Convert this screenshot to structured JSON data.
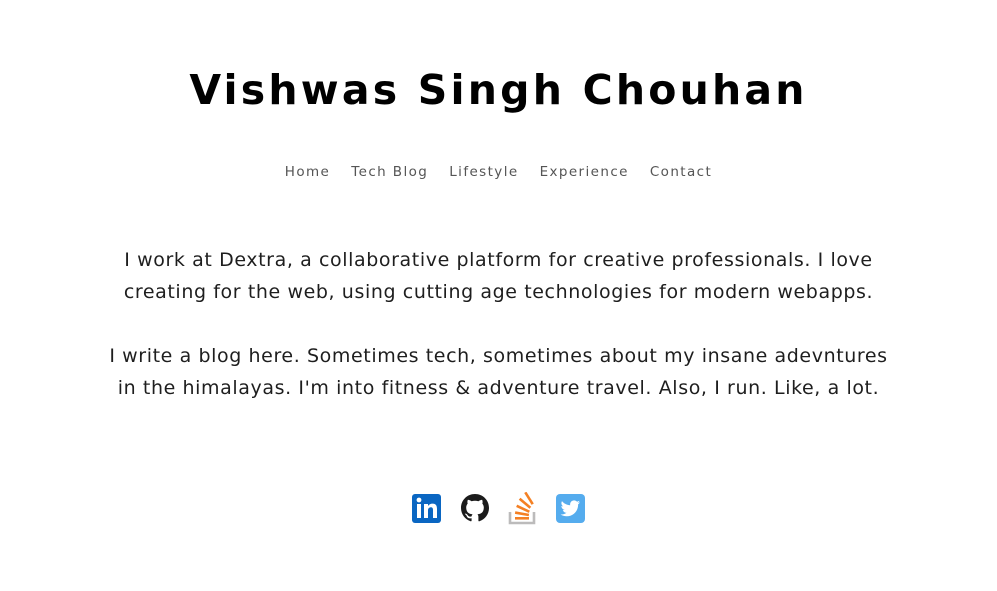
{
  "header": {
    "title": "Vishwas Singh Chouhan"
  },
  "nav": {
    "items": [
      {
        "label": "Home"
      },
      {
        "label": "Tech Blog"
      },
      {
        "label": "Lifestyle"
      },
      {
        "label": "Experience"
      },
      {
        "label": "Contact"
      }
    ]
  },
  "bio": {
    "paragraph_1": "I work at Dextra, a collaborative platform for creative professionals. I love creating for the web, using cutting age technologies for modern webapps.",
    "paragraph_2": "I write a blog here. Sometimes tech, sometimes about my insane adevntures in the himalayas. I'm into fitness & adventure travel. Also, I run. Like, a lot."
  },
  "social": {
    "links": [
      {
        "icon": "linkedin-icon",
        "color": "#0a66c2"
      },
      {
        "icon": "github-icon",
        "color": "#1b1b1b"
      },
      {
        "icon": "stackoverflow-icon",
        "color": "#f48024"
      },
      {
        "icon": "twitter-icon",
        "color": "#55acee"
      }
    ]
  }
}
